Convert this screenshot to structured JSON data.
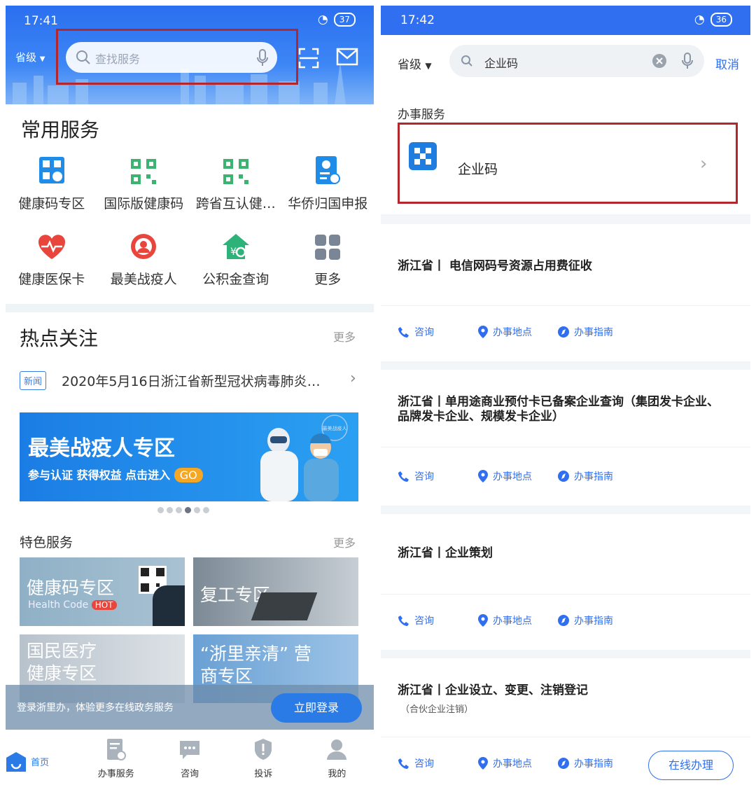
{
  "left": {
    "status": {
      "time": "17:41",
      "battery": "37"
    },
    "header": {
      "region": "省级",
      "search_placeholder": "查找服务"
    },
    "common": {
      "title": "常用服务",
      "items": [
        "健康码专区",
        "国际版健康码",
        "跨省互认健…",
        "华侨归国申报",
        "健康医保卡",
        "最美战疫人",
        "公积金查询",
        "更多"
      ]
    },
    "hot": {
      "title": "热点关注",
      "more": "更多",
      "news_tag": "新闻",
      "news_text": "2020年5月16日浙江省新型冠状病毒肺炎…",
      "banner_title": "最美战疫人专区",
      "banner_sub": "参与认证 获得权益 点击进入",
      "banner_go": "GO",
      "seal": "最美战疫人"
    },
    "featured": {
      "title": "特色服务",
      "more": "更多",
      "tiles": [
        {
          "title": "健康码专区",
          "sub": "Health Code",
          "badge": "HOT"
        },
        {
          "title": "复工专区"
        },
        {
          "title": "国民医疗 健康专区"
        },
        {
          "title": "“浙里亲清” 营商专区"
        }
      ]
    },
    "login": {
      "text": "登录浙里办，体验更多在线政务服务",
      "button": "立即登录"
    },
    "tabs": [
      "首页",
      "办事服务",
      "咨询",
      "投诉",
      "我的"
    ]
  },
  "right": {
    "status": {
      "time": "17:42",
      "battery": "36"
    },
    "header": {
      "region": "省级",
      "search_value": "企业码",
      "cancel": "取消"
    },
    "section_title": "办事服务",
    "result": "企业码",
    "actions": [
      "咨询",
      "办事地点",
      "办事指南"
    ],
    "online_button": "在线办理",
    "cards": [
      {
        "title": "浙江省丨 电信网码号资源占用费征收"
      },
      {
        "title": "浙江省丨单用途商业预付卡已备案企业查询（集团发卡企业、品牌发卡企业、规模发卡企业）"
      },
      {
        "title": "浙江省丨企业策划"
      },
      {
        "title": "浙江省丨企业设立、变更、注销登记",
        "sub": "（合伙企业注销）"
      }
    ]
  },
  "colors": {
    "primary": "#2f6ff0",
    "highlight": "#b3262c"
  }
}
